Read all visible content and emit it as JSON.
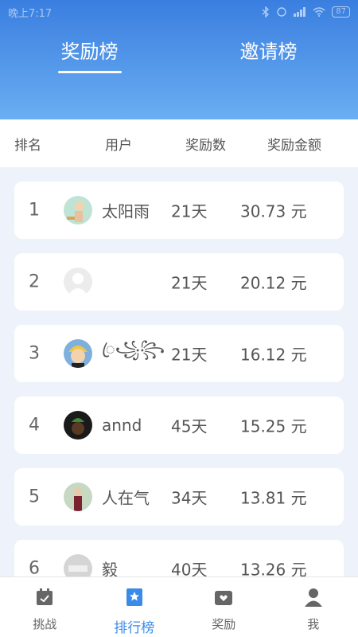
{
  "status": {
    "time": "晚上7:17",
    "battery": "87"
  },
  "tabs": [
    {
      "label": "奖励榜"
    },
    {
      "label": "邀请榜"
    }
  ],
  "columns": {
    "rank": "排名",
    "user": "用户",
    "count": "奖励数",
    "amount": "奖励金额"
  },
  "rows": [
    {
      "rank": "1",
      "user": "太阳雨",
      "days": "21天",
      "amount": "30.73 元"
    },
    {
      "rank": "2",
      "user": "",
      "days": "21天",
      "amount": "20.12 元"
    },
    {
      "rank": "3",
      "user": "ꦿ꧁꧂",
      "days": "21天",
      "amount": "16.12 元"
    },
    {
      "rank": "4",
      "user": "annd",
      "days": "45天",
      "amount": "15.25 元"
    },
    {
      "rank": "5",
      "user": "人在气",
      "days": "34天",
      "amount": "13.81 元"
    },
    {
      "rank": "6",
      "user": "毅",
      "days": "40天",
      "amount": "13.26 元"
    }
  ],
  "nav": [
    {
      "label": "挑战",
      "icon": "calendar-check-icon"
    },
    {
      "label": "排行榜",
      "icon": "star-bookmark-icon"
    },
    {
      "label": "奖励",
      "icon": "wallet-heart-icon"
    },
    {
      "label": "我",
      "icon": "person-icon"
    }
  ],
  "colors": {
    "accent": "#3a8be8",
    "header_top": "#3a7ee0",
    "header_bottom": "#6aaef2"
  }
}
